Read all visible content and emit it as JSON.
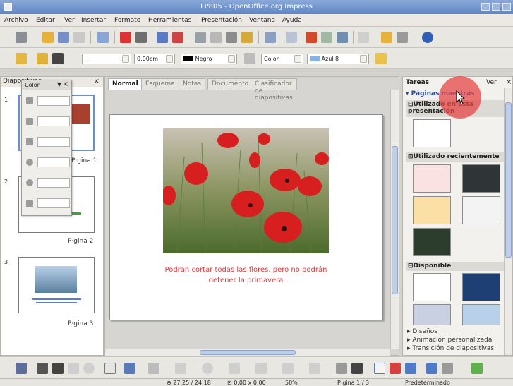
{
  "window": {
    "title": "LP805 - OpenOffice.org Impress"
  },
  "menu": [
    "Archivo",
    "Editar",
    "Ver",
    "Insertar",
    "Formato",
    "Herramientas",
    "Presentación",
    "Ventana",
    "Ayuda"
  ],
  "line_toolbar": {
    "width_value": "0,00cm",
    "line_color": "Negro",
    "fill_type": "Color",
    "fill_color": "Azul 8"
  },
  "slides_panel": {
    "title": "Diapositivas",
    "slides": [
      {
        "number": "1",
        "label": "P·gina 1"
      },
      {
        "number": "2",
        "label": "P·gina 2"
      },
      {
        "number": "3",
        "label": "P·gina 3"
      }
    ]
  },
  "color_toolbar": {
    "title": "Color"
  },
  "view_tabs": [
    "Normal",
    "Esquema",
    "Notas",
    "Documento",
    "Clasificador de diapositivas"
  ],
  "slide": {
    "caption_line1": "Podrán cortar todas las flores, pero no podrán",
    "caption_line2": "detener la primavera"
  },
  "tasks_panel": {
    "title": "Tareas",
    "view_label": "Ver",
    "master_pages": "Páginas maestras",
    "used_in_presentation": "Utilizado en esta presentación",
    "recently_used": "Utilizado recientemente",
    "available": "Disponible",
    "links": [
      "Diseños",
      "Animación personalizada",
      "Transición de diapositivas"
    ]
  },
  "status": {
    "position": "27.25 / 24.18",
    "size": "0.00 x 0.00",
    "zoom": "50%",
    "page": "P·gina 1 / 3",
    "layout": "Predeterminado"
  },
  "colors": {
    "caption_red": "#e23a3a",
    "accent_blue": "#5f86c6",
    "highlight": "#e64646"
  }
}
